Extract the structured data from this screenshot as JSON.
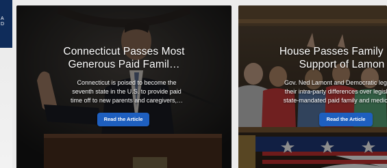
{
  "brand": {
    "letters": [
      "A",
      "D"
    ]
  },
  "cards": [
    {
      "title_line1": "Connecticut Passes Most",
      "title_line2": "Generous Paid Famil…",
      "excerpt_line1": "Connecticut is poised to become the",
      "excerpt_line2": "seventh state in the U.S. to provide paid",
      "excerpt_line3": "time off to new parents and caregivers,…",
      "button_label": "Read the Article"
    },
    {
      "title_line1": "House Passes Family Lea",
      "title_line2": "Support of Lamon",
      "excerpt_line1": "Gov. Ned Lamont and Democratic legislat",
      "excerpt_line2": "their intra-party differences over legislatio",
      "excerpt_line3": "state-mandated paid family and medical le",
      "button_label": "Read the Article"
    }
  ],
  "colors": {
    "button": "#1e5fbf",
    "sidebar_brand": "#0f2c5a"
  }
}
